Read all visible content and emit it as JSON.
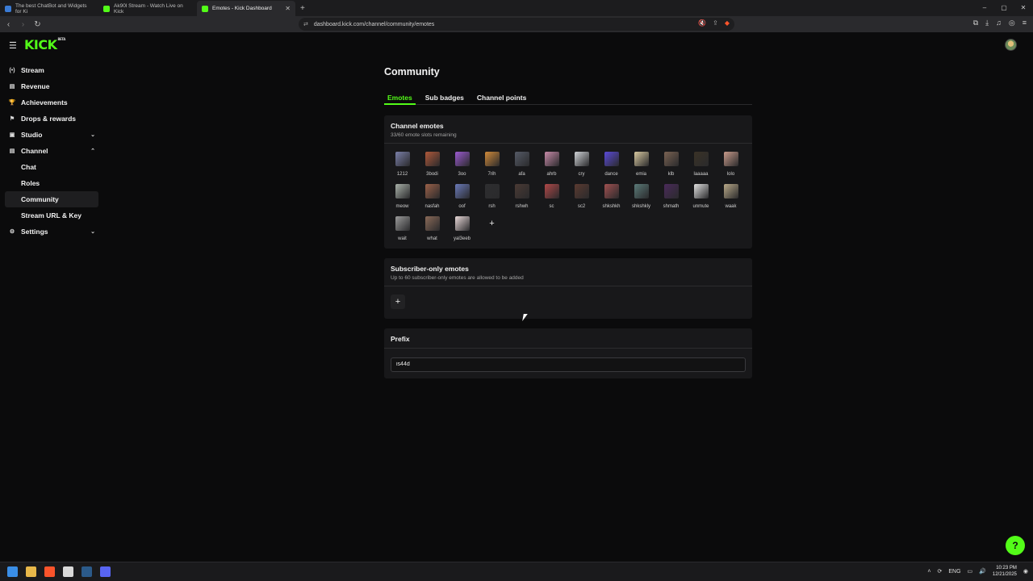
{
  "browser": {
    "tabs": [
      {
        "title": "The best ChatBot and Widgets for Ki",
        "fav_color": "#3a7bd5"
      },
      {
        "title": "Ak90l Stream - Watch Live on Kick",
        "fav_color": "#53fc18"
      },
      {
        "title": "Emotes - Kick Dashboard",
        "fav_color": "#53fc18"
      }
    ],
    "new_tab": "+",
    "url": "dashboard.kick.com/channel/community/emotes",
    "window_controls": {
      "minimize": "–",
      "maximize": "▢",
      "close": "✕"
    }
  },
  "header": {
    "logo": "KICK",
    "logo_tag": "BETA"
  },
  "sidebar": {
    "items": [
      {
        "label": "Stream",
        "icon": "(•)"
      },
      {
        "label": "Revenue",
        "icon": "▤"
      },
      {
        "label": "Achievements",
        "icon": "🏆"
      },
      {
        "label": "Drops & rewards",
        "icon": "⚑"
      },
      {
        "label": "Studio",
        "icon": "▣",
        "chevron": "⌄"
      },
      {
        "label": "Channel",
        "icon": "▤",
        "chevron": "⌃"
      },
      {
        "label": "Chat"
      },
      {
        "label": "Roles"
      },
      {
        "label": "Community"
      },
      {
        "label": "Stream URL & Key"
      },
      {
        "label": "Settings",
        "icon": "⚙",
        "chevron": "⌄"
      }
    ]
  },
  "main": {
    "title": "Community",
    "tabs": [
      "Emotes",
      "Sub badges",
      "Channel points"
    ],
    "channel_emotes": {
      "title": "Channel emotes",
      "subtitle": "33/60 emote slots remaining",
      "emotes": [
        {
          "name": "1212",
          "color": "#7a7fa8"
        },
        {
          "name": "3bodi",
          "color": "#b0583a"
        },
        {
          "name": "3oo",
          "color": "#9b5ad0"
        },
        {
          "name": "7rih",
          "color": "#d08a3a"
        },
        {
          "name": "afa",
          "color": "#555a66"
        },
        {
          "name": "ahrb",
          "color": "#c78aa8"
        },
        {
          "name": "cry",
          "color": "#cfd2d6"
        },
        {
          "name": "dance",
          "color": "#5a4ad8"
        },
        {
          "name": "emia",
          "color": "#d8c9a0"
        },
        {
          "name": "klb",
          "color": "#7a6252"
        },
        {
          "name": "laaaaa",
          "color": "#3a3226"
        },
        {
          "name": "lolo",
          "color": "#c89a8a"
        },
        {
          "name": "meow",
          "color": "#a8b0a8"
        },
        {
          "name": "nasfah",
          "color": "#9a6048"
        },
        {
          "name": "oof",
          "color": "#6a7ab8"
        },
        {
          "name": "rsh",
          "color": "#2e2e30"
        },
        {
          "name": "rshwh",
          "color": "#4a3a34"
        },
        {
          "name": "sc",
          "color": "#b04848"
        },
        {
          "name": "sc2",
          "color": "#5a3a30"
        },
        {
          "name": "shkshkh",
          "color": "#a05050"
        },
        {
          "name": "shkshkly",
          "color": "#5a7a78"
        },
        {
          "name": "shmath",
          "color": "#4a2a5a"
        },
        {
          "name": "unmute",
          "color": "#e0e0e0"
        },
        {
          "name": "waak",
          "color": "#b8a888"
        },
        {
          "name": "wait",
          "color": "#9a9a9a"
        },
        {
          "name": "what",
          "color": "#8a6a58"
        },
        {
          "name": "yal3eeb",
          "color": "#e8d8d8"
        }
      ],
      "add_label": "+"
    },
    "subscriber_emotes": {
      "title": "Subscriber-only emotes",
      "subtitle": "Up to 60 subscriber-only emotes are allowed to be added",
      "add_label": "+"
    },
    "prefix": {
      "title": "Prefix",
      "value": "is44d"
    }
  },
  "help_button": "?",
  "taskbar": {
    "language": "ENG",
    "time": "10:23 PM",
    "date": "12/21/2025",
    "apps": [
      {
        "name": "windows",
        "color": "#3a8ee6"
      },
      {
        "name": "explorer",
        "color": "#e8b84a"
      },
      {
        "name": "brave",
        "color": "#fb542b"
      },
      {
        "name": "chrome",
        "color": "#d9d9d9"
      },
      {
        "name": "steam",
        "color": "#2b5a8a"
      },
      {
        "name": "discord",
        "color": "#5865f2"
      }
    ]
  }
}
